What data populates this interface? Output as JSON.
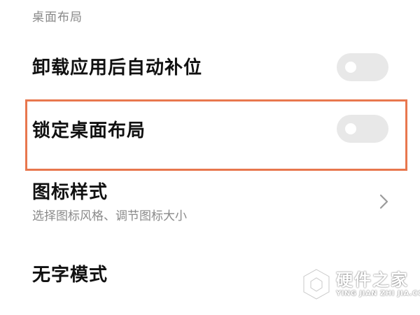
{
  "section": {
    "title": "桌面布局"
  },
  "settings": {
    "auto_fill": {
      "label": "卸载应用后自动补位",
      "toggle_state": "off"
    },
    "lock_layout": {
      "label": "锁定桌面布局",
      "toggle_state": "off",
      "highlighted": true
    },
    "icon_style": {
      "label": "图标样式",
      "description": "选择图标风格、调节图标大小",
      "icon": "chevron-right-icon"
    },
    "no_text_mode": {
      "label": "无字模式"
    }
  },
  "watermark": {
    "title": "硬件之家",
    "subtitle": "YING JIAN ZHI JIA.COM"
  },
  "colors": {
    "highlight_border": "#e8774e",
    "toggle_off_track": "#e8e8e8",
    "section_header": "#8a8a8a"
  }
}
